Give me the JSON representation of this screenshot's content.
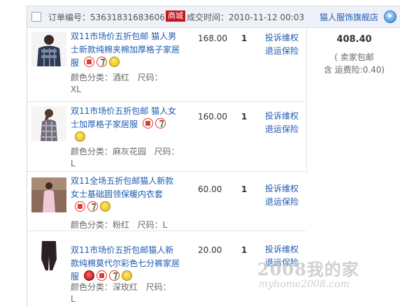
{
  "header": {
    "order_label": "订单编号：53631831683606",
    "mall_badge": "商城",
    "deal_time_label": "成交时间：2010-11-12 00:03",
    "shop_name": "猫人服饰旗舰店"
  },
  "items": [
    {
      "title": "双11市场价五折包邮 猫人男士新款纯棉夹棉加厚格子家居服",
      "badges": [
        "xiao-icon",
        "seven-day-icon",
        "gold-icon"
      ],
      "color_label": "颜色分类：酒红",
      "size_label": "尺码：",
      "size_value": "XL",
      "price": "168.00",
      "qty": "1",
      "action1": "投诉维权",
      "action2": "退运保险"
    },
    {
      "title": "双11市场价五折包邮 猫人女士加厚格子家居服",
      "badges": [
        "xiao-icon",
        "seven-day-icon",
        "gold-icon"
      ],
      "color_label": "颜色分类：麻灰花园",
      "size_label": "尺码：",
      "size_value": "L",
      "price": "160.00",
      "qty": "1",
      "action1": "投诉维权",
      "action2": "退运保险"
    },
    {
      "title": "双11全场五折包邮猫人新款女士基础圆领保暖内衣套",
      "badges": [
        "xiao-icon",
        "seven-day-icon",
        "gold-icon"
      ],
      "color_label": "颜色分类：粉红",
      "size_label": "尺码：L",
      "size_value": "",
      "price": "60.00",
      "qty": "1",
      "action1": "投诉维权",
      "action2": "退运保险"
    },
    {
      "title": "双11市场价五折包邮猫人新款纯棉莫代尔彩色七分裤家居服",
      "badges": [
        "red-icon",
        "xiao-icon",
        "seven-day-icon",
        "gold-icon"
      ],
      "color_label": "颜色分类：深玫红",
      "size_label": "尺码：",
      "size_value": "L",
      "price": "20.00",
      "qty": "1",
      "action1": "投诉维权",
      "action2": "退运保险"
    }
  ],
  "total": {
    "amount": "408.40",
    "note1": "( 卖家包邮",
    "note2": "含 运费险:0.40)"
  },
  "watermark": {
    "line1": "2008我的家",
    "line2": "myhome2008.com"
  },
  "colors": {
    "link": "#1d5bb0",
    "mall_badge_bg": "#c4161c",
    "header_bg": "#eef2f8"
  }
}
